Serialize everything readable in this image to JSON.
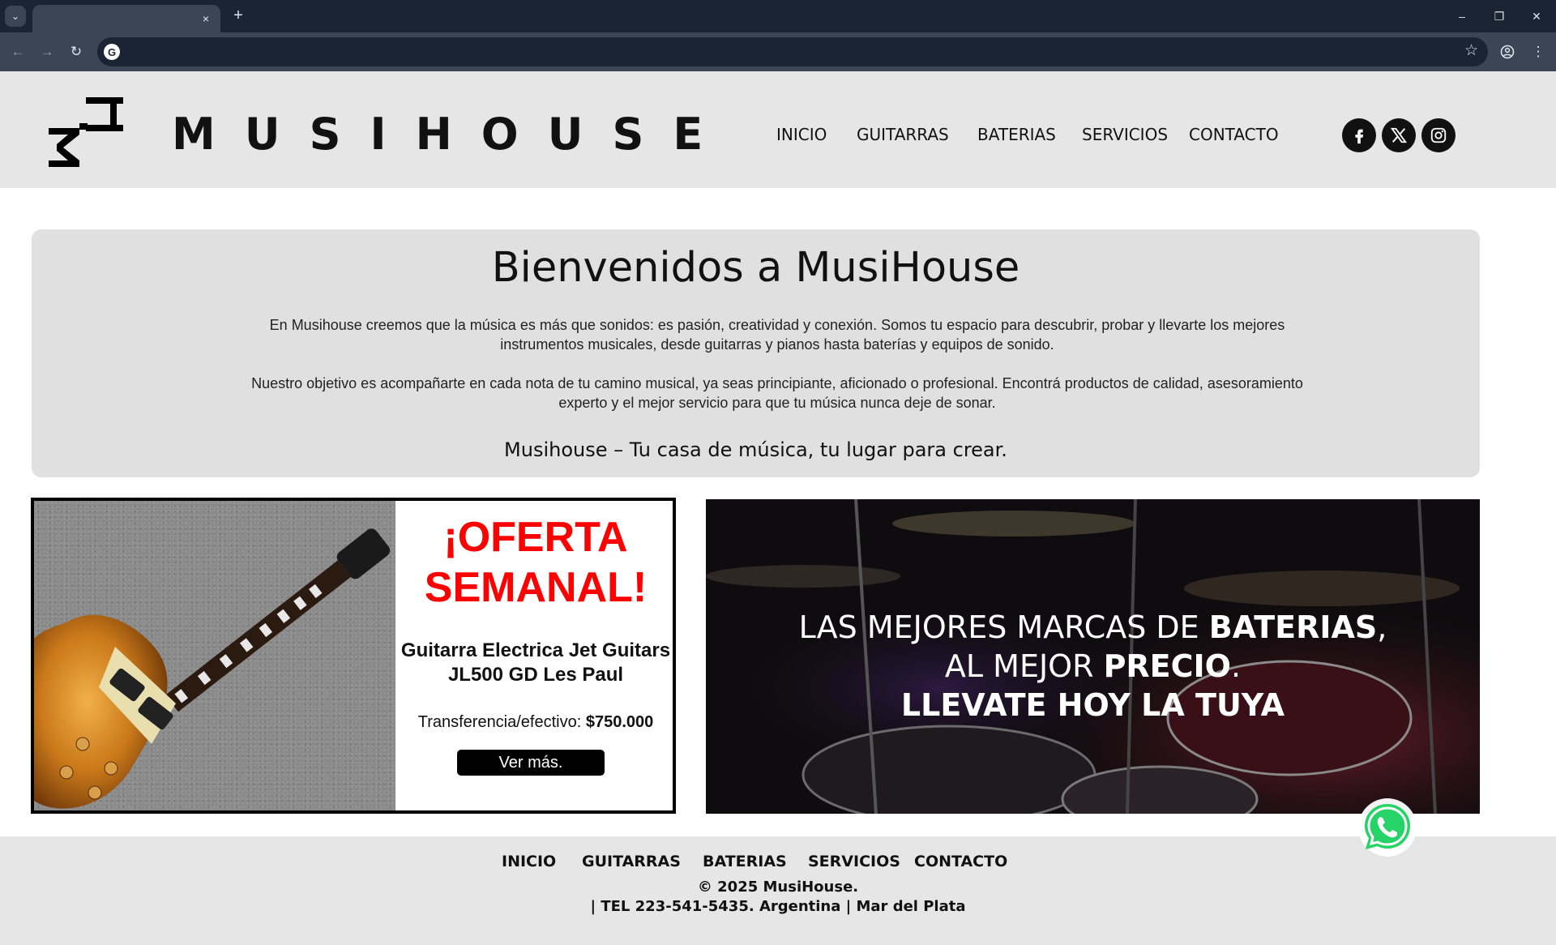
{
  "browser": {
    "tab_close": "×",
    "new_tab": "+",
    "window_controls": {
      "minimize": "–",
      "restore": "❐",
      "close": "✕"
    },
    "address": ""
  },
  "header": {
    "logo_text": "MH",
    "brand": "MUSIHOUSE",
    "nav": [
      "INICIO",
      "GUITARRAS",
      "BATERIAS",
      "SERVICIOS",
      "CONTACTO"
    ],
    "social": [
      "facebook-icon",
      "x-icon",
      "instagram-icon"
    ]
  },
  "welcome": {
    "title": "Bienvenidos a MusiHouse",
    "paragraph_1": "En Musihouse creemos que la música es más que sonidos: es pasión, creatividad y conexión. Somos tu espacio para descubrir, probar y llevarte los mejores instrumentos musicales, desde guitarras y pianos hasta baterías y equipos de sonido.",
    "paragraph_2": "Nuestro objetivo es acompañarte en cada nota de tu camino musical, ya seas principiante, aficionado o profesional. Encontrá productos de calidad, asesoramiento experto y el mejor servicio para que tu música nunca deje de sonar.",
    "tagline": "Musihouse – Tu casa de música, tu lugar para crear."
  },
  "offer": {
    "title_line_1": "¡OFERTA",
    "title_line_2": "SEMANAL!",
    "product": "Guitarra Electrica Jet Guitars JL500 GD Les Paul",
    "price_label": "Transferencia/efectivo: ",
    "price": "$750.000",
    "button": "Ver más."
  },
  "drums_banner": {
    "l1_a": "LAS MEJORES MARCAS DE ",
    "l1_b": "BATERIAS",
    "l1_c": ",",
    "l2_a": "AL MEJOR ",
    "l2_b": "PRECIO",
    "l2_c": ".",
    "l3": "LLEVATE HOY LA TUYA"
  },
  "footer": {
    "nav": [
      "INICIO",
      "GUITARRAS",
      "BATERIAS",
      "SERVICIOS",
      "CONTACTO"
    ],
    "copyright": "© 2025 MusiHouse.",
    "contact": "| TEL 223-541-5435.  Argentina | Mar del Plata"
  },
  "colors": {
    "offer_red": "#ff0000",
    "whatsapp_green": "#25d366",
    "header_bg": "#e6e6e6",
    "welcome_bg": "#e0e0e0"
  }
}
